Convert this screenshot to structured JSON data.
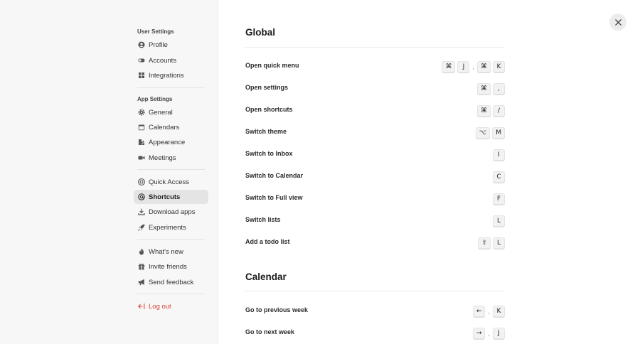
{
  "sidebar": {
    "user_settings_title": "User Settings",
    "app_settings_title": "App Settings",
    "items": {
      "profile": "Profile",
      "accounts": "Accounts",
      "integrations": "Integrations",
      "general": "General",
      "calendars": "Calendars",
      "appearance": "Appearance",
      "meetings": "Meetings",
      "quick_access": "Quick Access",
      "shortcuts": "Shortcuts",
      "download_apps": "Download apps",
      "experiments": "Experiments",
      "whats_new": "What's new",
      "invite_friends": "Invite friends",
      "send_feedback": "Send feedback",
      "log_out": "Log out"
    },
    "active_item": "Shortcuts"
  },
  "global": {
    "title": "Global",
    "rows": [
      {
        "label": "Open quick menu",
        "k1": "⌘",
        "k2": "J",
        "sep": ",",
        "k3": "⌘",
        "k4": "K"
      },
      {
        "label": "Open settings",
        "k1": "⌘",
        "k2": ","
      },
      {
        "label": "Open shortcuts",
        "k1": "⌘",
        "k2": "/"
      },
      {
        "label": "Switch theme",
        "k1": "⌥",
        "k2": "M"
      },
      {
        "label": "Switch to Inbox",
        "k1": "I"
      },
      {
        "label": "Switch to Calendar",
        "k1": "C"
      },
      {
        "label": "Switch to Full view",
        "k1": "F"
      },
      {
        "label": "Switch lists",
        "k1": "L"
      },
      {
        "label": "Add a todo list",
        "k1": "⇧",
        "k2": "L"
      }
    ]
  },
  "calendar": {
    "title": "Calendar",
    "rows": [
      {
        "label": "Go to previous week",
        "k1": "←",
        "sep": ",",
        "k2": "K"
      },
      {
        "label": "Go to next week",
        "k1": "→",
        "sep": ",",
        "k2": "J"
      }
    ]
  },
  "colors": {
    "logout": "#d9433b",
    "active_bg": "#e4e4e4",
    "sidebar_bg": "#f7f7f7"
  }
}
